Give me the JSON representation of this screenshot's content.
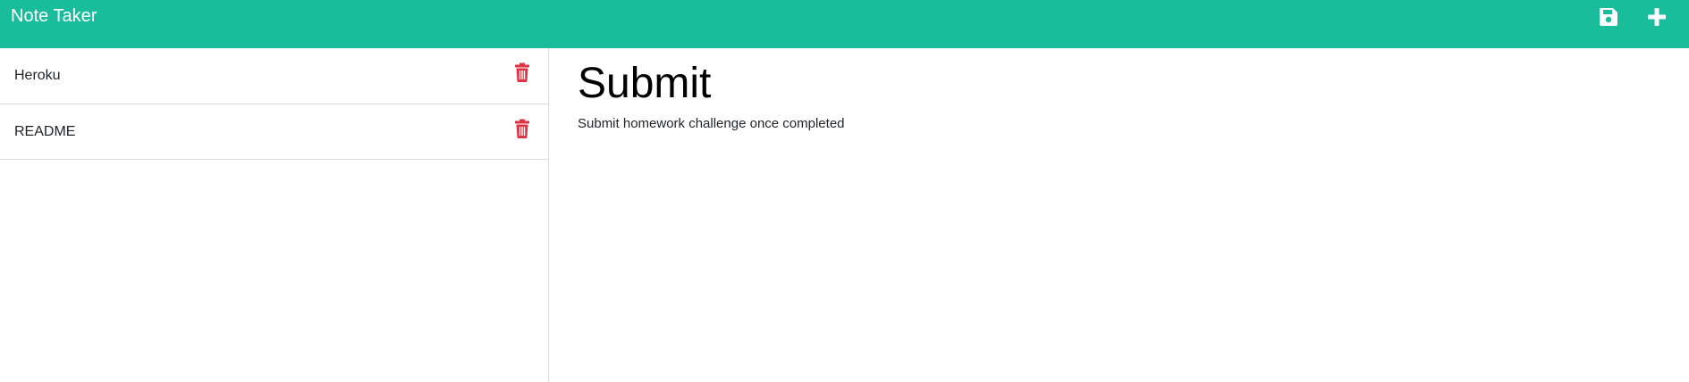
{
  "app": {
    "title": "Note Taker",
    "accent_color": "#19bd9b",
    "delete_color": "#dc3545"
  },
  "toolbar": {
    "save_icon": "floppy-disk-icon",
    "new_icon": "plus-icon"
  },
  "notes": [
    {
      "title": "Heroku",
      "delete_icon": "trash-icon"
    },
    {
      "title": "README",
      "delete_icon": "trash-icon"
    }
  ],
  "active_note": {
    "title": "Submit",
    "text": "Submit homework challenge once completed"
  }
}
